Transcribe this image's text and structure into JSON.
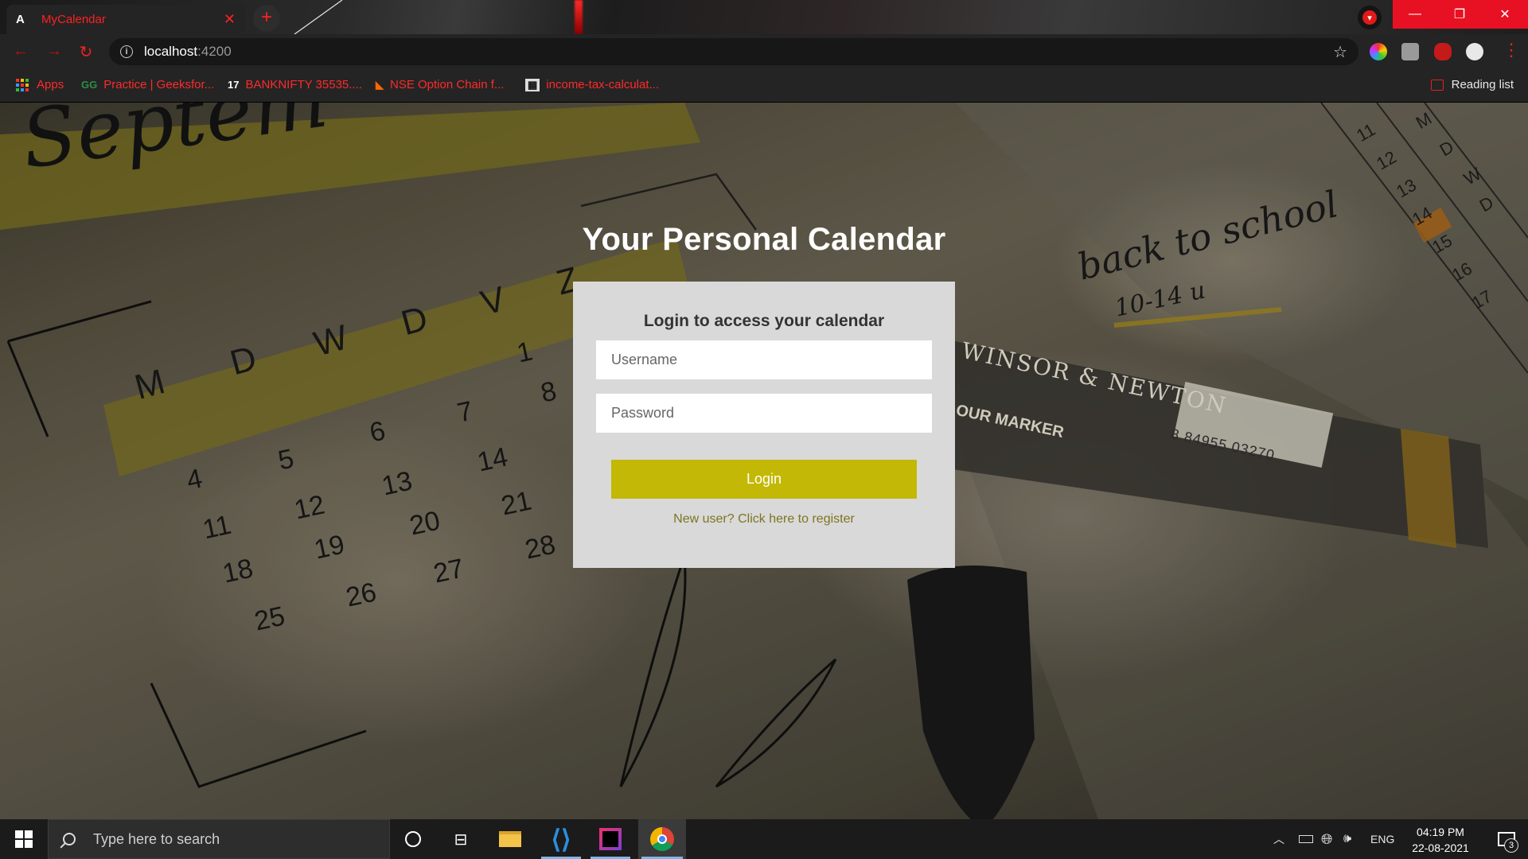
{
  "browser": {
    "tab": {
      "title": "MyCalendar",
      "favicon": "angular-icon"
    },
    "url": {
      "host": "localhost",
      "port": ":4200"
    },
    "bookmarks": [
      {
        "label": "Apps",
        "icon": "apps-grid-icon"
      },
      {
        "label": "Practice | Geeksfor...",
        "icon": "geeksforgeeks-icon"
      },
      {
        "label": "BANKNIFTY 35535....",
        "icon": "tradingview-icon"
      },
      {
        "label": "NSE Option Chain f...",
        "icon": "nse-icon"
      },
      {
        "label": "income-tax-calculat...",
        "icon": "calculator-icon"
      }
    ],
    "reading_list": "Reading list"
  },
  "page": {
    "title": "Your Personal Calendar",
    "login": {
      "heading": "Login to access your calendar",
      "username_placeholder": "Username",
      "password_placeholder": "Password",
      "button_label": "Login",
      "register_link": "New user? Click here to register"
    },
    "background_scene": {
      "month": "Septem",
      "weekdays": [
        "M",
        "D",
        "W",
        "D",
        "V",
        "Z"
      ],
      "dates": [
        "1",
        "4",
        "5",
        "6",
        "7",
        "8",
        "11",
        "12",
        "13",
        "14",
        "18",
        "19",
        "20",
        "21",
        "25",
        "26",
        "27",
        "28"
      ],
      "note": "back to school",
      "note_dates": "10-14 u",
      "marker_brand": "WINSOR & NEWTON",
      "marker_type": "OUR MARKER",
      "barcode": "8 84955 03270",
      "side_table": [
        "M",
        "D",
        "W",
        "D",
        "11",
        "12",
        "13",
        "14",
        "15",
        "16",
        "17"
      ]
    }
  },
  "taskbar": {
    "search_placeholder": "Type here to search",
    "language": "ENG",
    "time": "04:19 PM",
    "date": "22-08-2021",
    "notification_count": "3"
  },
  "colors": {
    "accent_red": "#ff2a2a",
    "login_button": "#c3b805",
    "register_link": "#7d7424",
    "card_bg": "#d9d9d9"
  }
}
